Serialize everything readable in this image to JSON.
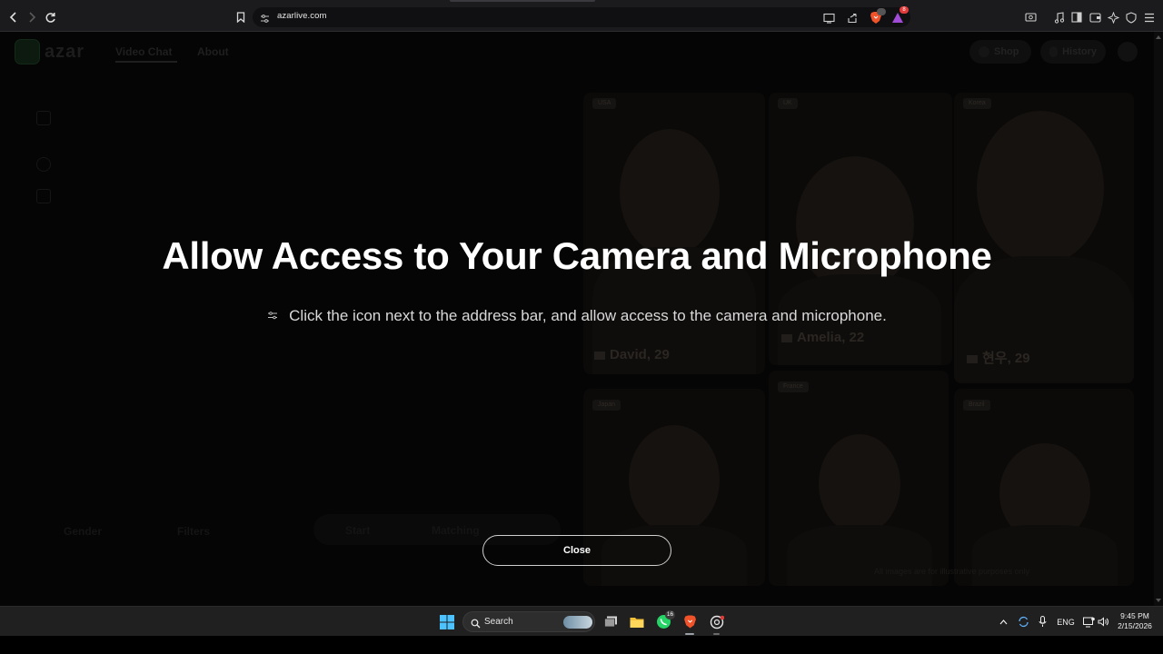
{
  "browser": {
    "url": "azarlive.com",
    "brave_badge_count": "8"
  },
  "site": {
    "logo_text": "azar",
    "nav": [
      {
        "label": "Video Chat",
        "active": true
      },
      {
        "label": "About",
        "active": false
      }
    ],
    "shop_label": "Shop",
    "history_label": "History"
  },
  "tiles": [
    {
      "name": "David, 29",
      "tag": "USA"
    },
    {
      "name": "Amelia, 22",
      "tag": "UK"
    },
    {
      "name": "현우, 29",
      "tag": "Korea"
    },
    {
      "name": "",
      "tag": "Japan"
    },
    {
      "name": "",
      "tag": "France"
    },
    {
      "name": "",
      "tag": "Brazil"
    }
  ],
  "background_controls": {
    "left_label": "Gender",
    "mid_label": "Filters",
    "pill_left": "Start",
    "pill_right": "Matching"
  },
  "credit_text": "All images are for illustrative purposes only",
  "modal": {
    "title": "Allow Access to Your Camera and Microphone",
    "description": "Click the icon next to the address bar, and allow access to the camera and microphone.",
    "close_label": "Close"
  },
  "taskbar": {
    "search_label": "Search",
    "whatsapp_badge": "16",
    "language": "ENG",
    "time": "9:45 PM",
    "date": "2/15/2026"
  }
}
